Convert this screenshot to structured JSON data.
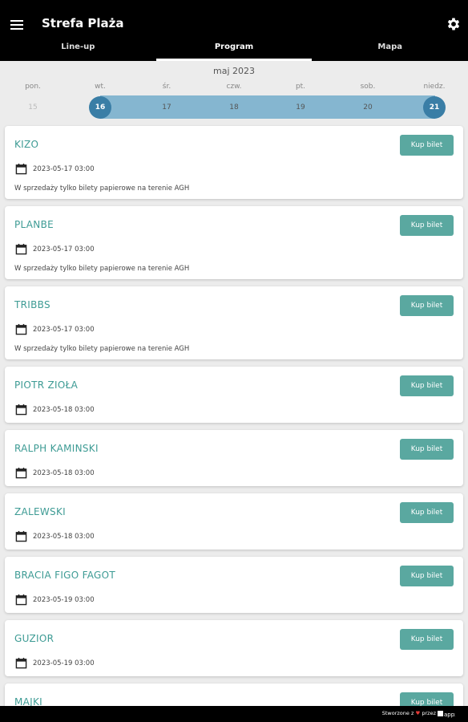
{
  "app": {
    "title": "Strefa Plaża"
  },
  "tabs": [
    {
      "label": "Line-up",
      "active": false
    },
    {
      "label": "Program",
      "active": true
    },
    {
      "label": "Mapa",
      "active": false
    }
  ],
  "calendar": {
    "month": "maj 2023",
    "weekdays": [
      "pon.",
      "wt.",
      "śr.",
      "czw.",
      "pt.",
      "sob.",
      "niedz."
    ],
    "days": [
      {
        "label": "15",
        "state": "disabled"
      },
      {
        "label": "16",
        "state": "selected"
      },
      {
        "label": "17",
        "state": "in-range"
      },
      {
        "label": "18",
        "state": "in-range"
      },
      {
        "label": "19",
        "state": "in-range"
      },
      {
        "label": "20",
        "state": "in-range"
      },
      {
        "label": "21",
        "state": "selected"
      }
    ]
  },
  "events": [
    {
      "artist": "KIZO",
      "date": "2023-05-17 03:00",
      "note": "W sprzedaży tylko bilety papierowe na terenie AGH",
      "button": "Kup bilet"
    },
    {
      "artist": "PLANBE",
      "date": "2023-05-17 03:00",
      "note": "W sprzedaży tylko bilety papierowe na terenie AGH",
      "button": "Kup bilet"
    },
    {
      "artist": "TRIBBS",
      "date": "2023-05-17 03:00",
      "note": "W sprzedaży tylko bilety papierowe na terenie AGH",
      "button": "Kup bilet"
    },
    {
      "artist": "PIOTR ZIOŁA",
      "date": "2023-05-18 03:00",
      "note": "",
      "button": "Kup bilet"
    },
    {
      "artist": "RALPH KAMINSKI",
      "date": "2023-05-18 03:00",
      "note": "",
      "button": "Kup bilet"
    },
    {
      "artist": "ZALEWSKI",
      "date": "2023-05-18 03:00",
      "note": "",
      "button": "Kup bilet"
    },
    {
      "artist": "BRACIA FIGO FAGOT",
      "date": "2023-05-19 03:00",
      "note": "",
      "button": "Kup bilet"
    },
    {
      "artist": "GUZIOR",
      "date": "2023-05-19 03:00",
      "note": "",
      "button": "Kup bilet"
    },
    {
      "artist": "MAJKI",
      "date": "",
      "note": "",
      "button": "Kup bilet"
    }
  ],
  "footer": {
    "prefix": "Stworzone z",
    "suffix": "przez",
    "brand": "appx"
  },
  "colors": {
    "accent": "#3d9b94",
    "button": "#5aa8a0",
    "range": "#85b6d0",
    "selected": "#3a7ea6"
  },
  "icons": {
    "menu": "menu-icon",
    "settings": "gear-icon",
    "date": "calendar-icon",
    "love": "heart-icon"
  }
}
